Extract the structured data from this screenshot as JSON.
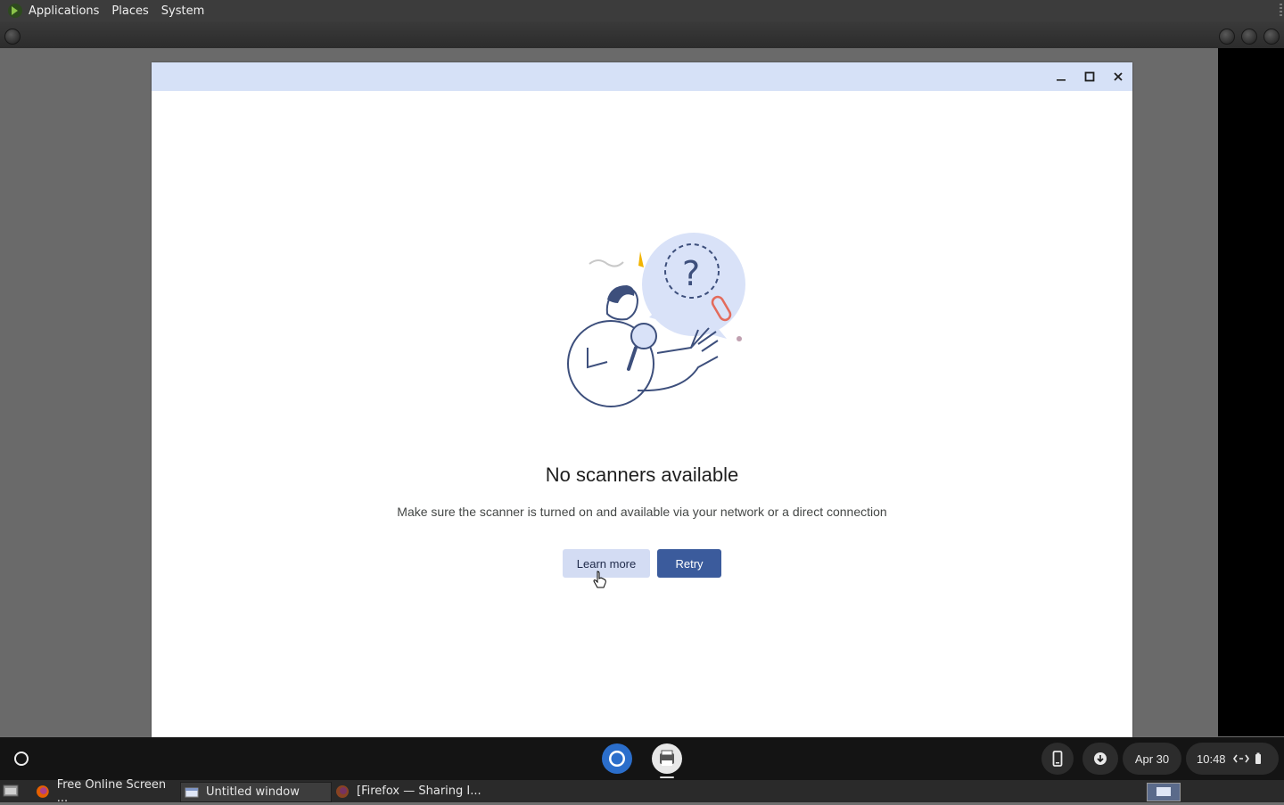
{
  "top_panel": {
    "menus": [
      "Applications",
      "Places",
      "System"
    ]
  },
  "window": {
    "title_buttons": [
      "minimize-icon",
      "maximize-icon",
      "close-icon"
    ],
    "heading": "No scanners available",
    "description": "Make sure the scanner is turned on and available via your network or a direct connection",
    "learn_more_label": "Learn more",
    "retry_label": "Retry"
  },
  "shelf": {
    "apps": [
      "chrome-icon",
      "scan-app-icon"
    ],
    "date": "Apr 30",
    "time": "10:48"
  },
  "taskbar": {
    "tasks": [
      {
        "label": "Free Online Screen ...",
        "icon": "firefox-icon"
      },
      {
        "label": "Untitled window",
        "icon": "window-icon"
      },
      {
        "label": "[Firefox — Sharing I...",
        "icon": "firefox-icon"
      }
    ]
  },
  "colors": {
    "titlebar": "#d6e1f7",
    "retry_button": "#3b5b9c",
    "learn_more_button": "#d3dcf3"
  }
}
